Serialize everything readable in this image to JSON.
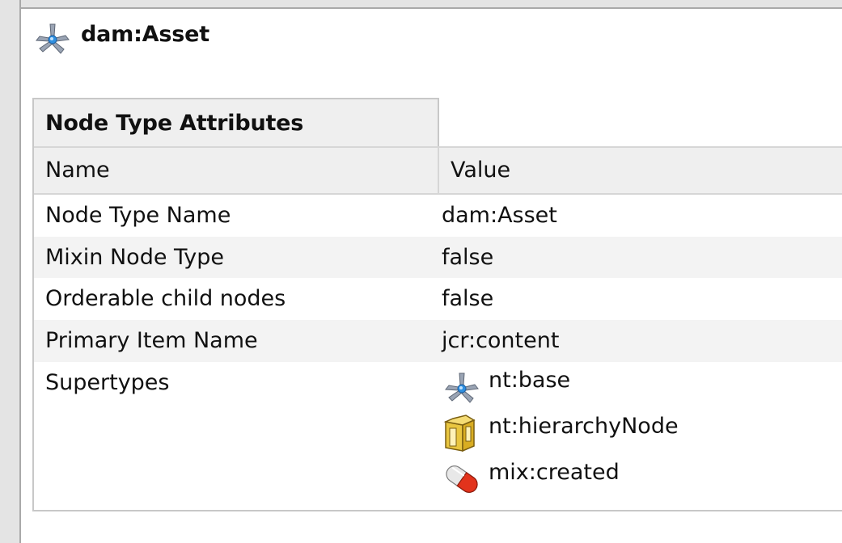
{
  "header": {
    "title": "dam:Asset",
    "icon": "nodetype-icon"
  },
  "table": {
    "caption": "Node Type Attributes",
    "columns": [
      "Name",
      "Value"
    ],
    "rows": [
      {
        "name": "Node Type Name",
        "value": "dam:Asset"
      },
      {
        "name": "Mixin Node Type",
        "value": "false"
      },
      {
        "name": "Orderable child nodes",
        "value": "false"
      },
      {
        "name": "Primary Item Name",
        "value": "jcr:content"
      },
      {
        "name": "Supertypes",
        "value": ""
      }
    ],
    "supertypes": [
      {
        "label": "nt:base",
        "icon": "nodetype-icon"
      },
      {
        "label": "nt:hierarchyNode",
        "icon": "folder-icon"
      },
      {
        "label": "mix:created",
        "icon": "pill-icon"
      }
    ]
  },
  "colors": {
    "header_bg": "#efefef",
    "alt_row_bg": "#f3f3f3",
    "border": "#c8c8c8",
    "gutter": "#e4e4e4"
  }
}
